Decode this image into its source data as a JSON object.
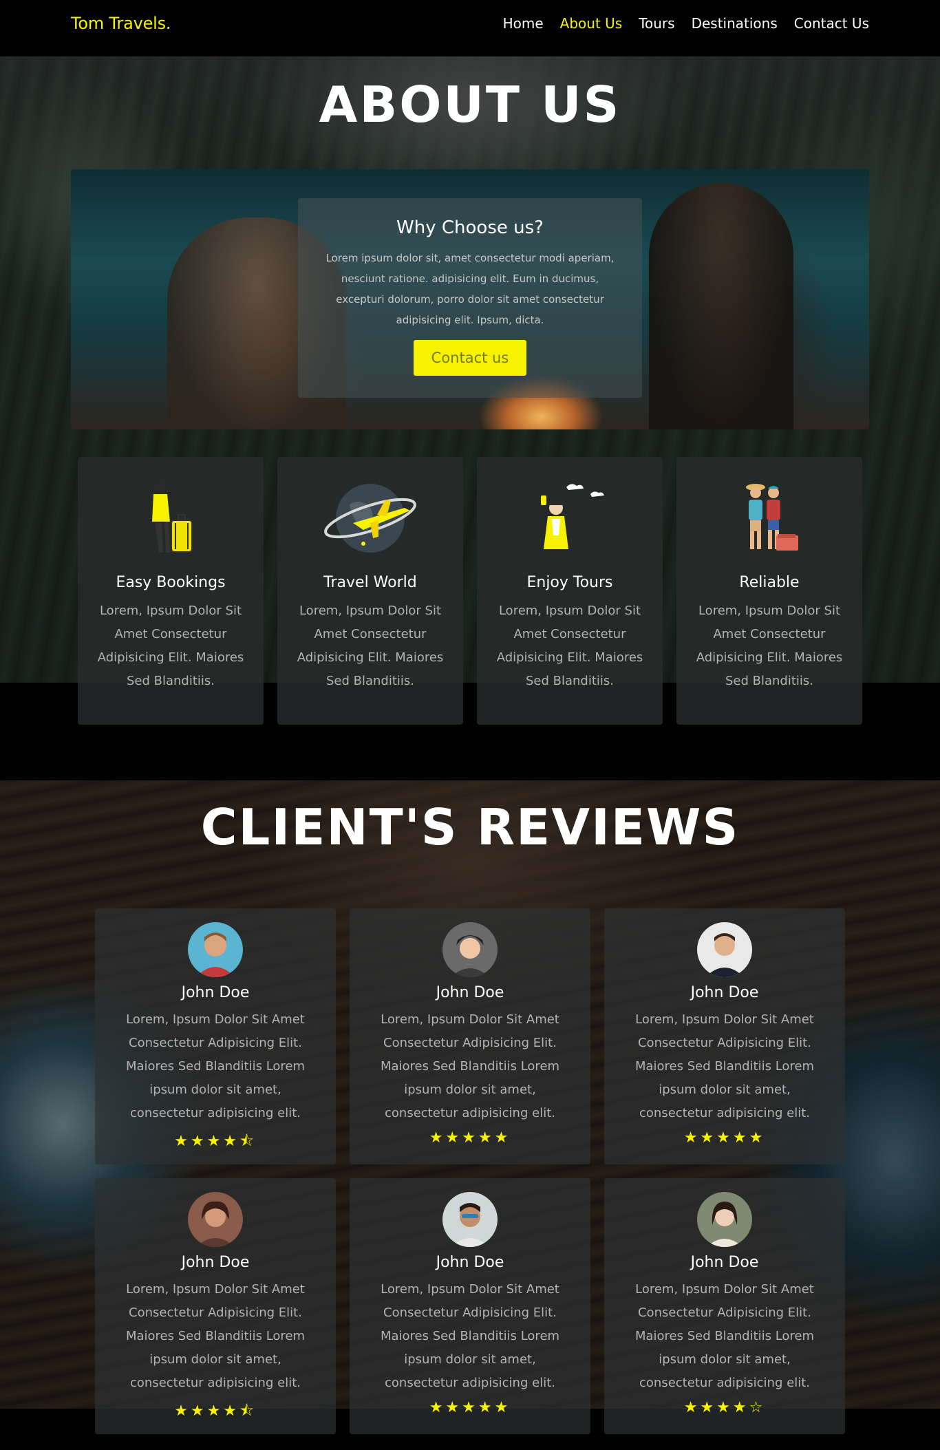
{
  "nav": {
    "brand": "Tom Travels.",
    "links": [
      "Home",
      "About Us",
      "Tours",
      "Destinations",
      "Contact Us"
    ],
    "active": "About Us"
  },
  "about": {
    "title": "ABOUT US",
    "why_title": "Why Choose us?",
    "why_text": "Lorem ipsum dolor sit, amet consectetur modi aperiam, nesciunt ratione. adipisicing elit. Eum in ducimus, excepturi dolorum, porro dolor sit amet consectetur adipisicing elit. Ipsum, dicta.",
    "button": "Contact us"
  },
  "features": [
    {
      "icon": "traveler-luggage-icon",
      "title": "Easy Bookings",
      "text": "Lorem, Ipsum Dolor Sit Amet Consectetur Adipisicing Elit. Maiores Sed Blanditiis."
    },
    {
      "icon": "globe-airplane-icon",
      "title": "Travel World",
      "text": "Lorem, Ipsum Dolor Sit Amet Consectetur Adipisicing Elit. Maiores Sed Blanditiis."
    },
    {
      "icon": "selfie-tourist-icon",
      "title": "Enjoy Tours",
      "text": "Lorem, Ipsum Dolor Sit Amet Consectetur Adipisicing Elit. Maiores Sed Blanditiis."
    },
    {
      "icon": "travel-couple-icon",
      "title": "Reliable",
      "text": "Lorem, Ipsum Dolor Sit Amet Consectetur Adipisicing Elit. Maiores Sed Blanditiis."
    }
  ],
  "reviews": {
    "title": "CLIENT'S REVIEWS",
    "items": [
      {
        "name": "John Doe",
        "text": "Lorem, Ipsum Dolor Sit Amet Consectetur Adipisicing Elit. Maiores Sed Blanditiis Lorem ipsum dolor sit amet, consectetur adipisicing elit.",
        "rating": 4.5,
        "stars": "★★★★⯪"
      },
      {
        "name": "John Doe",
        "text": "Lorem, Ipsum Dolor Sit Amet Consectetur Adipisicing Elit. Maiores Sed Blanditiis Lorem ipsum dolor sit amet, consectetur adipisicing elit.",
        "rating": 5,
        "stars": "★★★★★"
      },
      {
        "name": "John Doe",
        "text": "Lorem, Ipsum Dolor Sit Amet Consectetur Adipisicing Elit. Maiores Sed Blanditiis Lorem ipsum dolor sit amet, consectetur adipisicing elit.",
        "rating": 5,
        "stars": "★★★★★"
      },
      {
        "name": "John Doe",
        "text": "Lorem, Ipsum Dolor Sit Amet Consectetur Adipisicing Elit. Maiores Sed Blanditiis Lorem ipsum dolor sit amet, consectetur adipisicing elit.",
        "rating": 4.5,
        "stars": "★★★★⯪"
      },
      {
        "name": "John Doe",
        "text": "Lorem, Ipsum Dolor Sit Amet Consectetur Adipisicing Elit. Maiores Sed Blanditiis Lorem ipsum dolor sit amet, consectetur adipisicing elit.",
        "rating": 5,
        "stars": "★★★★★"
      },
      {
        "name": "John Doe",
        "text": "Lorem, Ipsum Dolor Sit Amet Consectetur Adipisicing Elit. Maiores Sed Blanditiis Lorem ipsum dolor sit amet, consectetur adipisicing elit.",
        "rating": 4,
        "stars": "★★★★☆"
      }
    ]
  },
  "colors": {
    "accent": "#f7f300",
    "card": "#2c3032",
    "text_muted": "#b3b3b3"
  }
}
